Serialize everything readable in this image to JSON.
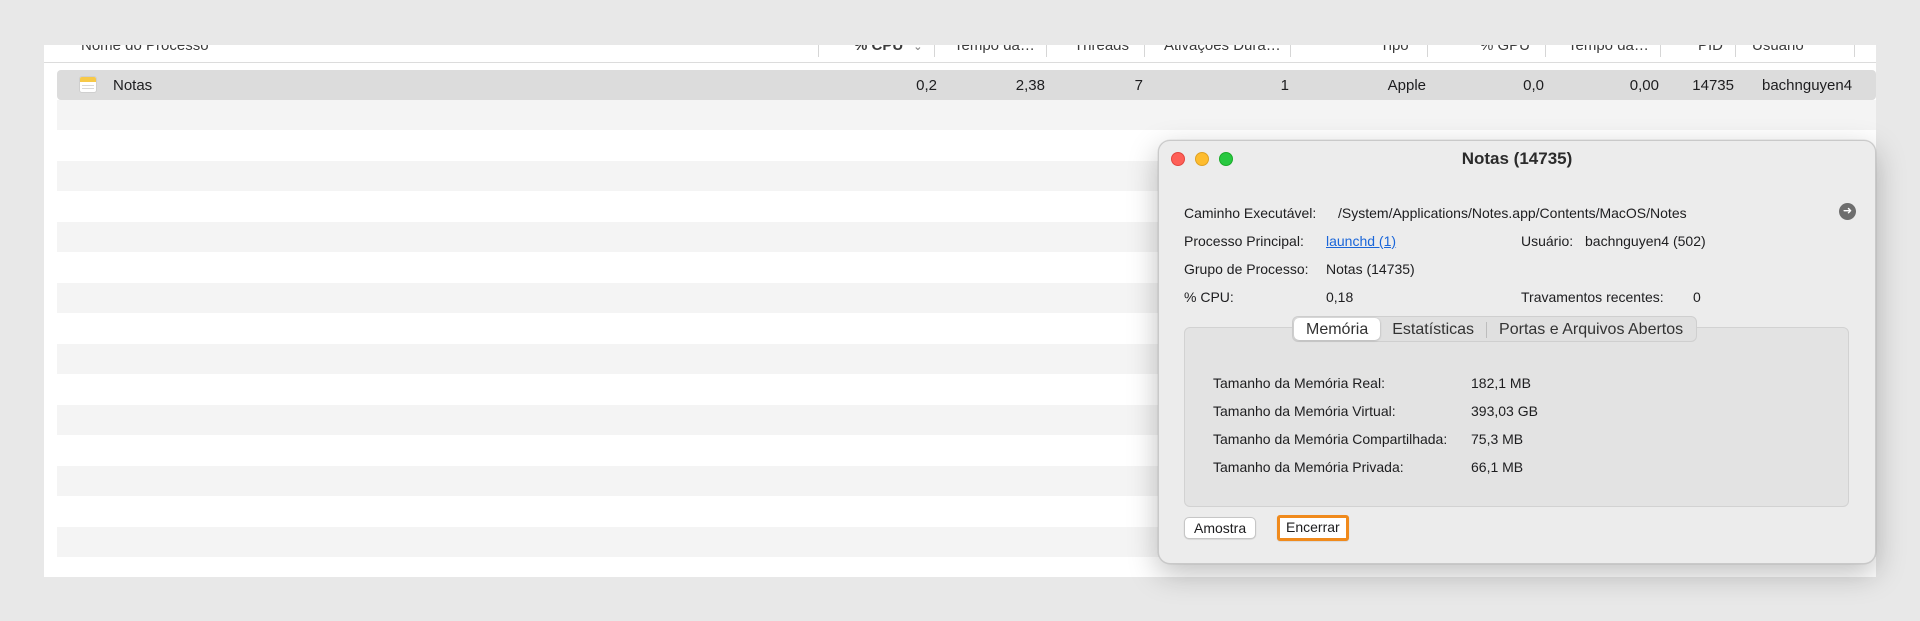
{
  "columns": {
    "name": "Nome do Processo",
    "cpu": "% CPU",
    "cpu_time": "Tempo da…",
    "threads": "Threads",
    "wakeups": "Ativações Dura…",
    "kind": "Tipo",
    "gpu": "% GPU",
    "gpu_time": "Tempo da…",
    "pid": "PID",
    "user": "Usuário"
  },
  "process_row": {
    "name": "Notas",
    "cpu": "0,2",
    "cpu_time": "2,38",
    "threads": "7",
    "wakeups": "1",
    "kind": "Apple",
    "gpu": "0,0",
    "gpu_time": "0,00",
    "pid": "14735",
    "user": "bachnguyen4"
  },
  "dialog": {
    "title": "Notas (14735)",
    "info": {
      "exec_path_label": "Caminho Executável:",
      "exec_path_value": "/System/Applications/Notes.app/Contents/MacOS/Notes",
      "parent_label": "Processo Principal:",
      "parent_value": "launchd (1)",
      "user_label": "Usuário:",
      "user_value": "bachnguyen4 (502)",
      "group_label": "Grupo de Processo:",
      "group_value": "Notas (14735)",
      "cpu_label": "% CPU:",
      "cpu_value": "0,18",
      "crashes_label": "Travamentos recentes:",
      "crashes_value": "0"
    },
    "tabs": [
      "Memória",
      "Estatísticas",
      "Portas e Arquivos Abertos"
    ],
    "memory": [
      {
        "label": "Tamanho da Memória Real:",
        "value": "182,1 MB"
      },
      {
        "label": "Tamanho da Memória Virtual:",
        "value": "393,03 GB"
      },
      {
        "label": "Tamanho da Memória Compartilhada:",
        "value": "75,3 MB"
      },
      {
        "label": "Tamanho da Memória Privada:",
        "value": "66,1 MB"
      }
    ],
    "buttons": {
      "sample": "Amostra",
      "quit": "Encerrar"
    }
  },
  "icons": {
    "app": "notes-app-icon",
    "sort": "chevron-down-icon",
    "reveal": "arrow-right-circle-icon"
  },
  "colors": {
    "focus_ring": "#f08a1c",
    "link": "#1a66d9",
    "close": "#fe5f57",
    "minimize": "#febc2e",
    "zoom": "#28c840"
  }
}
